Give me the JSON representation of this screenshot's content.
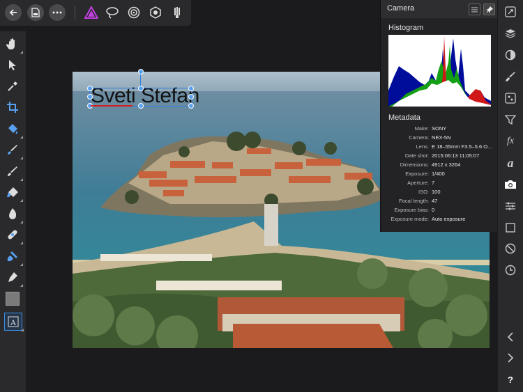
{
  "panel": {
    "title": "Camera",
    "histogram_title": "Histogram",
    "metadata_title": "Metadata",
    "metadata": [
      {
        "key": "Make:",
        "value": "SONY"
      },
      {
        "key": "Camera:",
        "value": "NEX-5N"
      },
      {
        "key": "Lens:",
        "value": "E 18–55mm F3.5–5.6 O..."
      },
      {
        "key": "Date shot:",
        "value": "2015:06:13 11:05:07"
      },
      {
        "key": "Dimensions:",
        "value": "4912 x 3264"
      },
      {
        "key": "Exposure:",
        "value": "1/400"
      },
      {
        "key": "Aperture:",
        "value": "7"
      },
      {
        "key": "ISO:",
        "value": "100"
      },
      {
        "key": "Focal length:",
        "value": "47"
      },
      {
        "key": "Exposure bias:",
        "value": "0"
      },
      {
        "key": "Exposure mode:",
        "value": "Auto exposure"
      }
    ]
  },
  "canvas": {
    "text_layer": "Sveti Stefan"
  },
  "colors": {
    "accent": "#3a8ee6",
    "persona_purple": "#c040e0"
  },
  "toolbar": {
    "icons": [
      "back-icon",
      "document-icon",
      "more-icon",
      "photo-persona-icon",
      "lasso-persona-icon",
      "liquify-persona-icon",
      "develop-persona-icon",
      "tone-mapping-persona-icon"
    ]
  },
  "left_tools": [
    "hand-icon",
    "move-icon",
    "color-picker-icon",
    "crop-icon",
    "flood-fill-icon",
    "selection-brush-icon",
    "paint-brush-icon",
    "erase-brush-icon",
    "burn-brush-icon",
    "healing-brush-icon",
    "clone-brush-icon",
    "pen-icon",
    "color-swatch-icon",
    "text-icon"
  ],
  "right_tools": [
    "navigator-icon",
    "layers-icon",
    "adjustments-icon",
    "brushes-icon",
    "channels-icon",
    "filters-icon",
    "fx-icon",
    "text-styles-icon",
    "camera-icon",
    "transform-icon",
    "crop-square-icon",
    "no-entry-icon",
    "history-icon",
    "undo-icon",
    "redo-icon",
    "help-icon"
  ],
  "help_label": "?"
}
